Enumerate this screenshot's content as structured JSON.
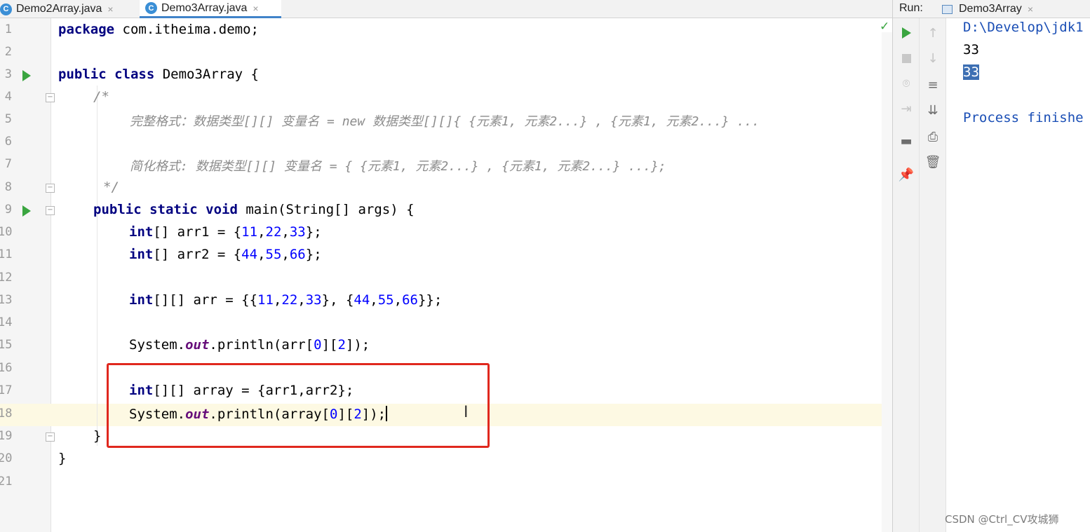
{
  "tabs": [
    {
      "label": "Demo2Array.java",
      "icon": "C",
      "close": "×"
    },
    {
      "label": "Demo3Array.java",
      "icon": "C",
      "close": "×"
    }
  ],
  "editor": {
    "line_numbers": [
      "1",
      "2",
      "3",
      "4",
      "5",
      "6",
      "7",
      "8",
      "9",
      "10",
      "11",
      "12",
      "13",
      "14",
      "15",
      "16",
      "17",
      "18",
      "19",
      "20",
      "21"
    ],
    "code": {
      "l1_kw": "package",
      "l1_rest": " com.itheima.demo;",
      "l3_kw": "public class",
      "l3_rest": " Demo3Array {",
      "l4": "/*",
      "l5": "完整格式：数据类型[][] 变量名 = new 数据类型[][]{ {元素1, 元素2...} , {元素1, 元素2...} ...",
      "l7": "简化格式: 数据类型[][] 变量名 = { {元素1, 元素2...} , {元素1, 元素2...} ...};",
      "l8": "*/",
      "l9_kw": "public static void",
      "l9_rest": " main(String[] args) {",
      "l10_kw": "int",
      "l10_a": "[] arr1 = {",
      "l10_n1": "11",
      "l10_c1": ",",
      "l10_n2": "22",
      "l10_c2": ",",
      "l10_n3": "33",
      "l10_end": "};",
      "l11_kw": "int",
      "l11_a": "[] arr2 = {",
      "l11_n1": "44",
      "l11_c1": ",",
      "l11_n2": "55",
      "l11_c2": ",",
      "l11_n3": "66",
      "l11_end": "};",
      "l13_kw": "int",
      "l13_a": "[][] arr = {{",
      "l13_n1": "11",
      "l13_c1": ",",
      "l13_n2": "22",
      "l13_c2": ",",
      "l13_n3": "33",
      "l13_b": "}, {",
      "l13_n4": "44",
      "l13_c3": ",",
      "l13_n5": "55",
      "l13_c4": ",",
      "l13_n6": "66",
      "l13_end": "}};",
      "l15_a": "System.",
      "l15_out": "out",
      "l15_b": ".println(arr[",
      "l15_n1": "0",
      "l15_c": "][",
      "l15_n2": "2",
      "l15_end": "]);",
      "l17_kw": "int",
      "l17_rest": "[][] array = {arr1,arr2};",
      "l18_a": "System.",
      "l18_out": "out",
      "l18_b": ".println(array[",
      "l18_n1": "0",
      "l18_c": "][",
      "l18_n2": "2",
      "l18_end": "]);",
      "l19": "}",
      "l20": "}"
    }
  },
  "run": {
    "label": "Run:",
    "tab_label": "Demo3Array",
    "close": "×",
    "console": {
      "path": "D:\\Develop\\jdk1",
      "line1": "33",
      "line2": "33",
      "finished": "Process finishe"
    }
  },
  "watermark": "CSDN @Ctrl_CV攻城狮",
  "colors": {
    "keyword": "#000080",
    "number": "#0000ff",
    "comment": "#8c8c8c",
    "static_field": "#660e7a",
    "highlight_box": "#e0281e",
    "run_green": "#3aa540"
  }
}
